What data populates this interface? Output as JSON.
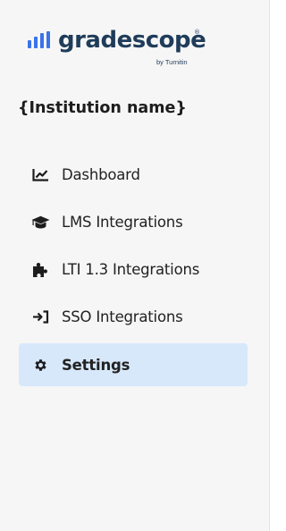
{
  "brand": {
    "name": "gradescope",
    "trademark": "®",
    "byline": "by Turnitin",
    "color": "#1f3c5a",
    "bars_color": "#3b73e8"
  },
  "institution": {
    "name": "{Institution name}"
  },
  "nav": {
    "items": [
      {
        "label": "Dashboard",
        "icon": "chart-line-icon",
        "active": false
      },
      {
        "label": "LMS Integrations",
        "icon": "graduation-cap-icon",
        "active": false
      },
      {
        "label": "LTI 1.3 Integrations",
        "icon": "puzzle-piece-icon",
        "active": false
      },
      {
        "label": "SSO Integrations",
        "icon": "sign-in-icon",
        "active": false
      },
      {
        "label": "Settings",
        "icon": "gear-icon",
        "active": true
      }
    ],
    "active_color": "#d7e8fb"
  }
}
